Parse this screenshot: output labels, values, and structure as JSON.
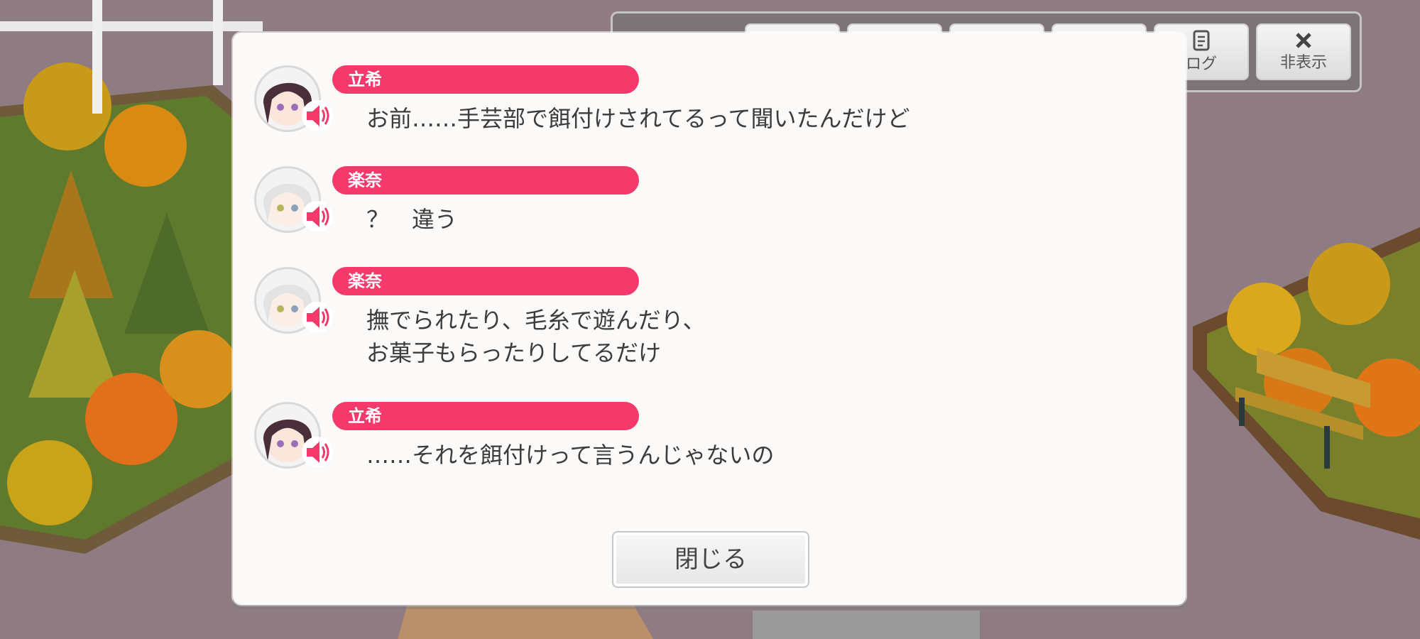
{
  "toolbar": {
    "buttons": [
      {
        "label": "",
        "icon": "unknown-icon"
      },
      {
        "label": "",
        "icon": "unknown-icon"
      },
      {
        "label": "",
        "icon": "unknown-icon"
      },
      {
        "label": "",
        "icon": "unknown-icon"
      },
      {
        "label": "ログ",
        "icon": "log-icon"
      },
      {
        "label": "非表示",
        "icon": "close-x-icon"
      }
    ]
  },
  "dialog": {
    "entries": [
      {
        "speaker": "立希",
        "lines": [
          "お前……手芸部で餌付けされてるって聞いたんだけど"
        ],
        "avatar": "dark-hair-avatar"
      },
      {
        "speaker": "楽奈",
        "lines": [
          "？　違う"
        ],
        "avatar": "white-hair-avatar"
      },
      {
        "speaker": "楽奈",
        "lines": [
          "撫でられたり、毛糸で遊んだり、",
          "お菓子もらったりしてるだけ"
        ],
        "avatar": "white-hair-avatar"
      },
      {
        "speaker": "立希",
        "lines": [
          "……それを餌付けって言うんじゃないの"
        ],
        "avatar": "dark-hair-avatar"
      }
    ],
    "close_label": "閉じる"
  },
  "colors": {
    "name_pill": "#f5396a",
    "speaker_icon": "#f5396a"
  }
}
